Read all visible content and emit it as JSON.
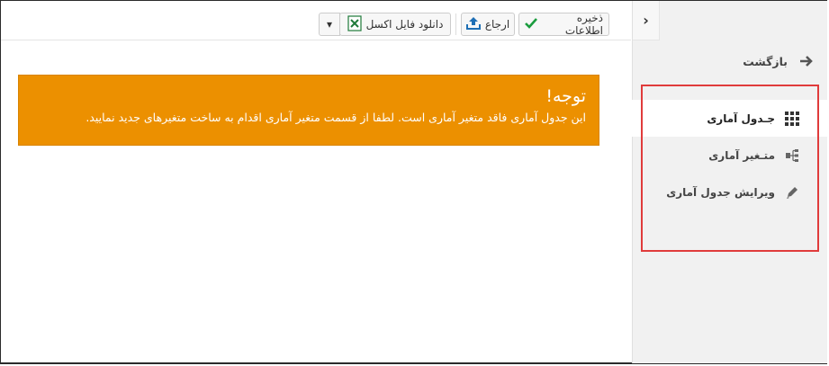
{
  "toolbar": {
    "save_label": "ذخیره اطلاعات",
    "return_label": "ارجاع",
    "download_label": "دانلود فایل اکسل",
    "dropdown_symbol": "▾",
    "save_icon": "check-icon",
    "return_icon": "upload-icon",
    "download_icon": "excel-icon"
  },
  "notice": {
    "title": "توجه!",
    "text": "این جدول آماری فاقد متغیر آماری است. لطفا از قسمت متغیر آماری اقدام به ساخت متغیرهای جدید نمایید."
  },
  "sidebar": {
    "collapse_symbol": "‹",
    "back_label": "بازگشت",
    "items": [
      {
        "label": "جـدول آماری",
        "icon": "grid-icon",
        "active": true
      },
      {
        "label": "متـغیر آماری",
        "icon": "hierarchy-icon",
        "active": false
      },
      {
        "label": "ویرایش جدول آماری",
        "icon": "pencil-icon",
        "active": false
      }
    ]
  },
  "colors": {
    "notice_bg": "#ec9000",
    "highlight": "#e03b3b",
    "check_green": "#1a9c3e",
    "upload_blue": "#1e6fb5",
    "excel_green": "#1f7a3a"
  }
}
